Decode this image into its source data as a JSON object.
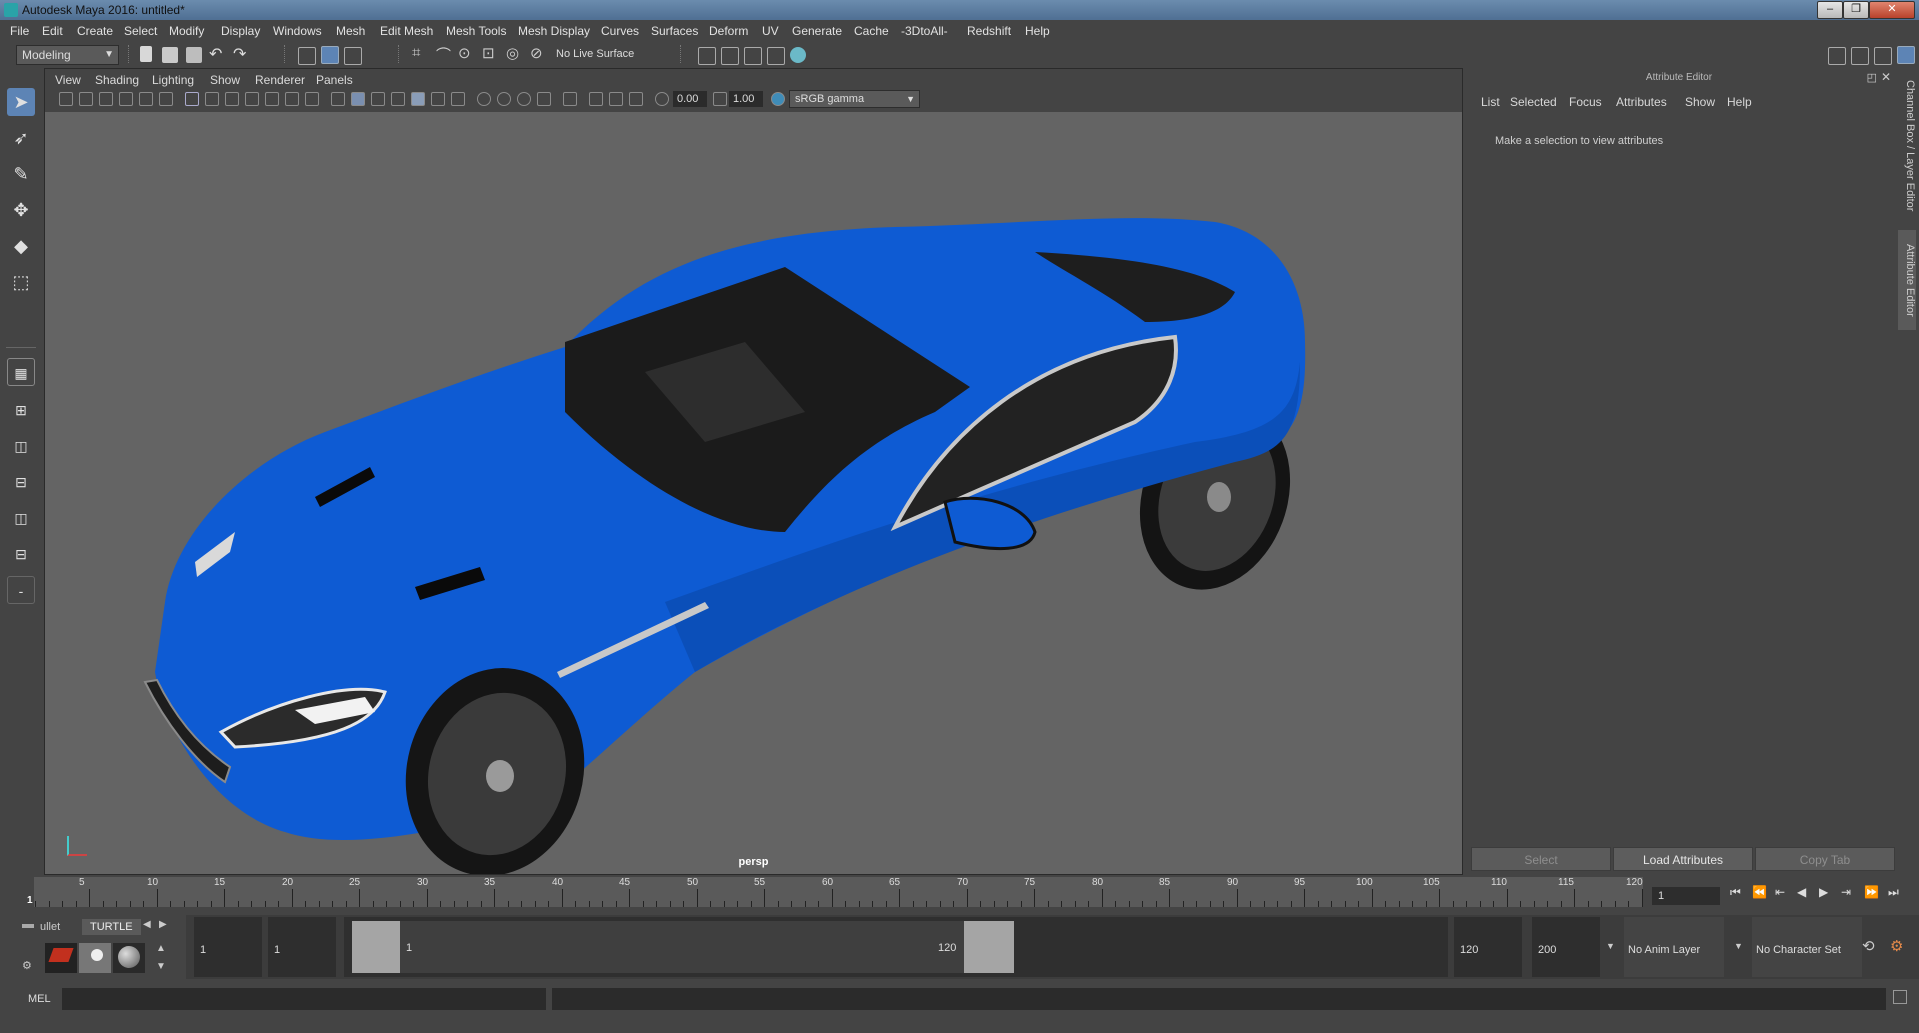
{
  "window": {
    "title": "Autodesk Maya 2016: untitled*"
  },
  "menubar": [
    "File",
    "Edit",
    "Create",
    "Select",
    "Modify",
    "Display",
    "Windows",
    "Mesh",
    "Edit Mesh",
    "Mesh Tools",
    "Mesh Display",
    "Curves",
    "Surfaces",
    "Deform",
    "UV",
    "Generate",
    "Cache",
    "-3DtoAll-",
    "Redshift",
    "Help"
  ],
  "statusline": {
    "mode": "Modeling",
    "live_surface": "No Live Surface"
  },
  "viewport": {
    "menu": [
      "View",
      "Shading",
      "Lighting",
      "Show",
      "Renderer",
      "Panels"
    ],
    "exposure": "0.00",
    "gamma": "1.00",
    "color_space": "sRGB gamma",
    "camera_label": "persp",
    "car_color": "#0e5bd3"
  },
  "attribute_editor": {
    "header": "Attribute Editor",
    "menu": [
      "List",
      "Selected",
      "Focus",
      "Attributes",
      "Show",
      "Help"
    ],
    "message": "Make a selection to view attributes",
    "buttons": {
      "select": "Select",
      "load": "Load Attributes",
      "copy": "Copy Tab"
    },
    "side_tabs": [
      "Channel Box / Layer Editor",
      "Attribute Editor"
    ]
  },
  "timeline": {
    "labels": [
      "5",
      "10",
      "15",
      "20",
      "25",
      "30",
      "35",
      "40",
      "45",
      "50",
      "55",
      "60",
      "65",
      "70",
      "75",
      "80",
      "85",
      "90",
      "95",
      "100",
      "105",
      "110",
      "115",
      "120"
    ],
    "current_marker": "1",
    "current_frame": "1"
  },
  "range": {
    "shelf_tabs": {
      "bullet": "ullet",
      "turtle": "TURTLE"
    },
    "start_time": "1",
    "playback_start": "1",
    "slider_start": "1",
    "slider_end": "120",
    "playback_end": "120",
    "end_time": "200",
    "anim_layer": "No Anim Layer",
    "character_set": "No Character Set"
  },
  "cmdline": {
    "label": "MEL"
  }
}
